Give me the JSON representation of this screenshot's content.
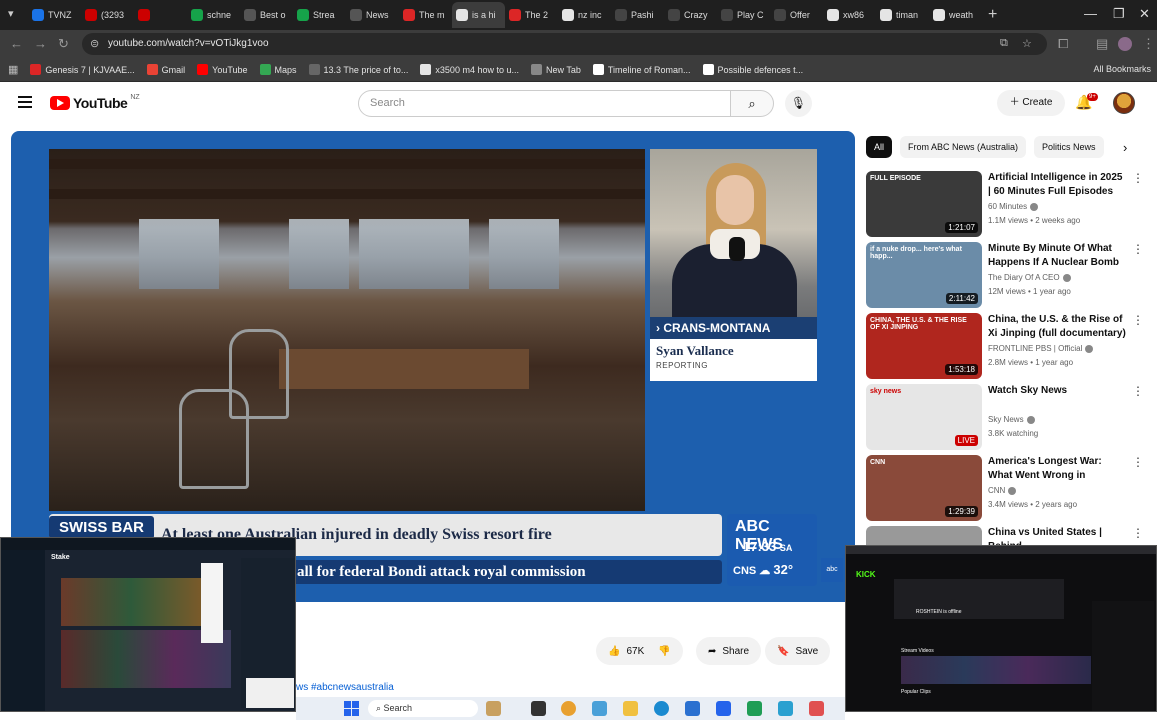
{
  "browser": {
    "tabs": [
      {
        "label": "TVNZ",
        "color": "#1a73e8"
      },
      {
        "label": "(3293",
        "color": "#cc0000"
      },
      {
        "label": "",
        "color": "#cc0000"
      },
      {
        "label": "schne",
        "color": "#16a34a"
      },
      {
        "label": "Best o",
        "color": "#555555"
      },
      {
        "label": "Strea",
        "color": "#16a34a"
      },
      {
        "label": "News",
        "color": "#555555"
      },
      {
        "label": "The m",
        "color": "#dc2626"
      },
      {
        "label": "is a hi",
        "color": "#e5e5e5"
      },
      {
        "label": "The 2",
        "color": "#dc2626"
      },
      {
        "label": "nz inc",
        "color": "#e5e5e5"
      },
      {
        "label": "Pashi",
        "color": "#444444"
      },
      {
        "label": "Crazy",
        "color": "#444444"
      },
      {
        "label": "Play C",
        "color": "#444444"
      },
      {
        "label": "Offer",
        "color": "#444444"
      },
      {
        "label": "xw86",
        "color": "#e5e5e5"
      },
      {
        "label": "timan",
        "color": "#e5e5e5"
      },
      {
        "label": "weath",
        "color": "#e5e5e5"
      }
    ],
    "new_tab": "+",
    "url": "youtube.com/watch?v=vOTiJkg1voo",
    "bookmarks": [
      {
        "label": "Genesis 7 | KJVAAE...",
        "color": "#dc2626"
      },
      {
        "label": "Gmail",
        "color": "#ea4335"
      },
      {
        "label": "YouTube",
        "color": "#ff0000"
      },
      {
        "label": "Maps",
        "color": "#34a853"
      },
      {
        "label": "13.3 The price of to...",
        "color": "#666666"
      },
      {
        "label": "x3500 m4 how to u...",
        "color": "#e5e5e5"
      },
      {
        "label": "New Tab",
        "color": "#888888"
      },
      {
        "label": "Timeline of Roman...",
        "color": "#ffffff"
      },
      {
        "label": "Possible defences t...",
        "color": "#ffffff"
      }
    ],
    "all_bookmarks": "All Bookmarks"
  },
  "youtube": {
    "logo_text": "YouTube",
    "country_code": "NZ",
    "search_placeholder": "Search",
    "create_label": "Create",
    "notif_count": "9+"
  },
  "video": {
    "location_tag": "CRANS-MONTANA",
    "reporter_name": "Syan Vallance",
    "reporter_role": "REPORTING",
    "lower_third_label": "SWISS BAR",
    "headline": "At least one Australian injured in deadly Swiss resort fire",
    "ticker": "all for federal Bondi attack royal commission",
    "abc_logo": "ABC NEWS",
    "time": "17:33",
    "time_zone": "SA",
    "weather_place": "CNS",
    "temperature": "32°"
  },
  "actions": {
    "likes": "67K",
    "share": "Share",
    "save": "Save"
  },
  "description_tags": "ws #abcnewsaustralia",
  "sidebar": {
    "chips": [
      "All",
      "From ABC News (Australia)",
      "Politics News"
    ],
    "videos": [
      {
        "title": "Artificial Intelligence in 2025 | 60 Minutes Full Episodes",
        "channel": "60 Minutes",
        "meta": "1.1M views • 2 weeks ago",
        "duration": "1:21:07",
        "thumb": "#3a3a3a",
        "badge": "FULL EPISODE"
      },
      {
        "title": "Minute By Minute Of What Happens If A Nuclear Bomb ...",
        "channel": "The Diary Of A CEO",
        "meta": "12M views • 1 year ago",
        "duration": "2:11:42",
        "thumb": "#6b8ca8",
        "badge": "if a nuke drop... here's what happ..."
      },
      {
        "title": "China, the U.S. & the Rise of Xi Jinping (full documentary) | ...",
        "channel": "FRONTLINE PBS | Official",
        "meta": "2.8M views • 1 year ago",
        "duration": "1:53:18",
        "thumb": "#b0261e",
        "badge": "CHINA, THE U.S. & THE RISE OF XI JINPING"
      },
      {
        "title": "Watch Sky News",
        "channel": "Sky News",
        "meta": "3.8K watching",
        "duration": "LIVE",
        "thumb": "#e6e6e6",
        "badge": "sky news"
      },
      {
        "title": "America's Longest War: What Went Wrong in Afghanistan ...",
        "channel": "CNN",
        "meta": "3.4M views • 2 years ago",
        "duration": "1:29:39",
        "thumb": "#8a4a3a",
        "badge": "CNN"
      },
      {
        "title": "China vs United States | Behind",
        "channel": "",
        "meta": "",
        "duration": "",
        "thumb": "#999999",
        "badge": ""
      }
    ]
  },
  "overlays": {
    "left_app": "Stake",
    "right_app": "KICK",
    "right_status": "ROSHTEIN is offline",
    "right_section_1": "Stream Videos",
    "right_section_2": "Popular Clips"
  },
  "taskbar": {
    "search": "Search"
  }
}
